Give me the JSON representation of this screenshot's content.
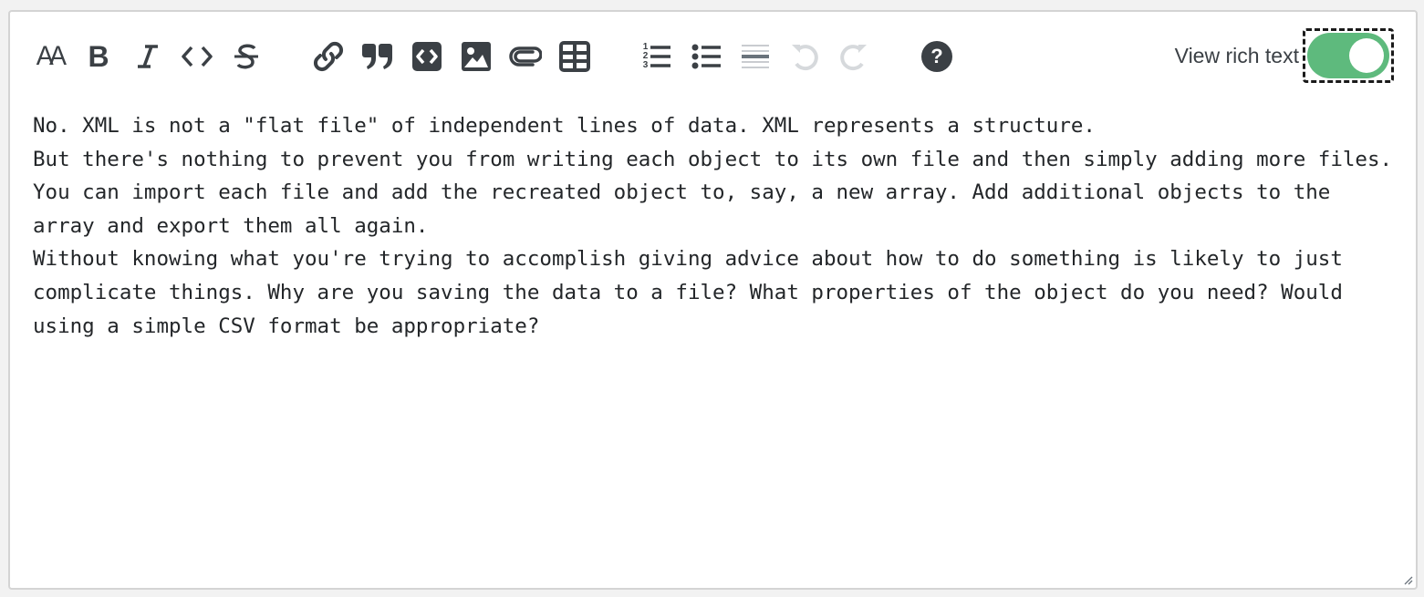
{
  "toolbar": {
    "buttons": [
      {
        "name": "text-size-button",
        "icon": "text-size-icon",
        "glyph": "AA"
      },
      {
        "name": "bold-button",
        "icon": "bold-icon",
        "glyph": "B"
      },
      {
        "name": "italic-button",
        "icon": "italic-icon",
        "glyph": "I"
      },
      {
        "name": "code-button",
        "icon": "code-icon",
        "glyph": "<>"
      },
      {
        "name": "strikethrough-button",
        "icon": "strikethrough-icon",
        "glyph": "S"
      },
      {
        "name": "link-button",
        "icon": "link-icon"
      },
      {
        "name": "blockquote-button",
        "icon": "quote-icon"
      },
      {
        "name": "code-block-button",
        "icon": "code-block-icon"
      },
      {
        "name": "image-button",
        "icon": "image-icon"
      },
      {
        "name": "attachment-button",
        "icon": "paperclip-icon"
      },
      {
        "name": "table-button",
        "icon": "table-icon"
      },
      {
        "name": "ordered-list-button",
        "icon": "ordered-list-icon"
      },
      {
        "name": "bullet-list-button",
        "icon": "bullet-list-icon"
      },
      {
        "name": "horizontal-rule-button",
        "icon": "horizontal-rule-icon",
        "disabled": true
      },
      {
        "name": "undo-button",
        "icon": "undo-icon",
        "disabled": true
      },
      {
        "name": "redo-button",
        "icon": "redo-icon",
        "disabled": true
      },
      {
        "name": "help-button",
        "icon": "help-icon"
      }
    ],
    "glyphs": {
      "text_size": "AA",
      "bold": "B",
      "italic": "I",
      "strike": "S",
      "list_numbers": [
        "1",
        "2",
        "3"
      ],
      "help": "?"
    },
    "toggle": {
      "label": "View rich text",
      "state": "on",
      "color": "#5eba7d"
    }
  },
  "editor": {
    "text": "No. XML is not a \"flat file\" of independent lines of data. XML represents a structure.\nBut there's nothing to prevent you from writing each object to its own file and then simply adding more files. You can import each file and add the recreated object to, say, a new array. Add additional objects to the array and export them all again.\nWithout knowing what you're trying to accomplish giving advice about how to do something is likely to just complicate things. Why are you saving the data to a file? What properties of the object do you need? Would using a simple CSV format be appropriate?"
  },
  "colors": {
    "icon": "#3b4045",
    "icon_disabled": "#d6d9dc",
    "text": "#232629",
    "border": "#d4d4d4",
    "toggle_on": "#5eba7d"
  }
}
